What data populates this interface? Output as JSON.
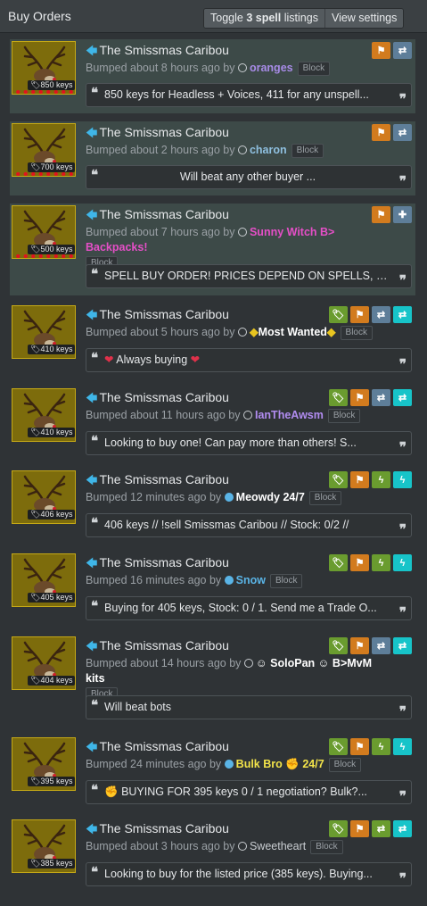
{
  "header": {
    "title": "Buy Orders",
    "toggle_prefix": "Toggle",
    "toggle_count": "3 spell",
    "toggle_suffix": "listings",
    "view_settings": "View settings"
  },
  "item_name": "The Smissmas Caribou",
  "block_label": "Block",
  "listings": [
    {
      "price": "850 keys",
      "bumped": "Bumped about 8 hours ago by",
      "user": "oranges",
      "user_color": "#a78be6",
      "quote": "850 keys for Headless + Voices, 411 for any unspell..."
    },
    {
      "price": "700 keys",
      "bumped": "Bumped about 2 hours ago by",
      "user": "charon",
      "user_color": "#8fc0e0",
      "quote": "Will beat any other buyer ..."
    },
    {
      "price": "500 keys",
      "bumped": "Bumped about 7 hours ago by",
      "user": "Sunny Witch B> Backpacks!",
      "user_color": "#e54fc7",
      "quote": "SPELL BUY ORDER! PRICES DEPEND ON SPELLS, C..."
    },
    {
      "price": "410 keys",
      "bumped": "Bumped about 5 hours ago by",
      "user": "Most Wanted",
      "user_color": "#ffffff",
      "quote": "Always buying"
    },
    {
      "price": "410 keys",
      "bumped": "Bumped about 11 hours ago by",
      "user": "IanTheAwsm",
      "user_color": "#b18cf0",
      "quote": "Looking to buy one! Can pay more than others! S..."
    },
    {
      "price": "406 keys",
      "bumped": "Bumped 12 minutes ago by",
      "user": "Meowdy 24/7",
      "user_color": "#ffffff",
      "quote": "406 keys // !sell Smissmas Caribou // Stock: 0/2 //"
    },
    {
      "price": "405 keys",
      "bumped": "Bumped 16 minutes ago by",
      "user": "Snow",
      "user_color": "#5ab4e6",
      "quote": "Buying for 405 keys, Stock: 0 / 1. Send me a Trade O..."
    },
    {
      "price": "404 keys",
      "bumped": "Bumped about 14 hours ago by",
      "user": "SoloPan",
      "user_suffix": "B>MvM kits",
      "user_color": "#ffffff",
      "quote": "Will beat bots"
    },
    {
      "price": "395 keys",
      "bumped": "Bumped 24 minutes ago by",
      "user": "Bulk Bro",
      "user_suffix": "24/7",
      "user_color": "#f3e44a",
      "quote": "BUYING FOR 395 keys 0 / 1 negotiation? Bulk?..."
    },
    {
      "price": "385 keys",
      "bumped": "Bumped about 3 hours ago by",
      "user": "Sweetheart",
      "user_color": "#c9cdd1",
      "quote": "Looking to buy for the listed price (385 keys). Buying..."
    }
  ]
}
